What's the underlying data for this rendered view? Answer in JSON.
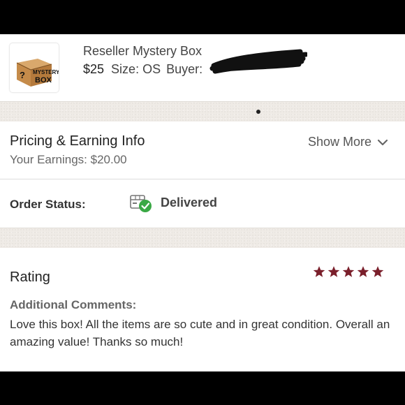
{
  "item": {
    "thumbnail_text": [
      "MYSTERY",
      "BOX"
    ],
    "thumbnail_mark": "?",
    "title": "Reseller Mystery Box",
    "price": "$25",
    "size": "Size: OS",
    "buyer_label": "Buyer:",
    "buyer_name_redacted": true
  },
  "pricing": {
    "title": "Pricing & Earning Info",
    "earnings": "Your Earnings: $20.00",
    "show_more": "Show More"
  },
  "order_status": {
    "label": "Order Status:",
    "value": "Delivered",
    "icon": "box-delivered-check-icon",
    "check_color": "#3aa845"
  },
  "rating": {
    "title": "Rating",
    "stars": 5,
    "star_color": "#7a1f2b",
    "comments_label": "Additional Comments:",
    "comment": "Love this box! All the items are so cute and in great condition. Overall an amazing value! Thanks so much!"
  },
  "colors": {
    "band": "#efebe6",
    "letterbox": "#000000"
  }
}
